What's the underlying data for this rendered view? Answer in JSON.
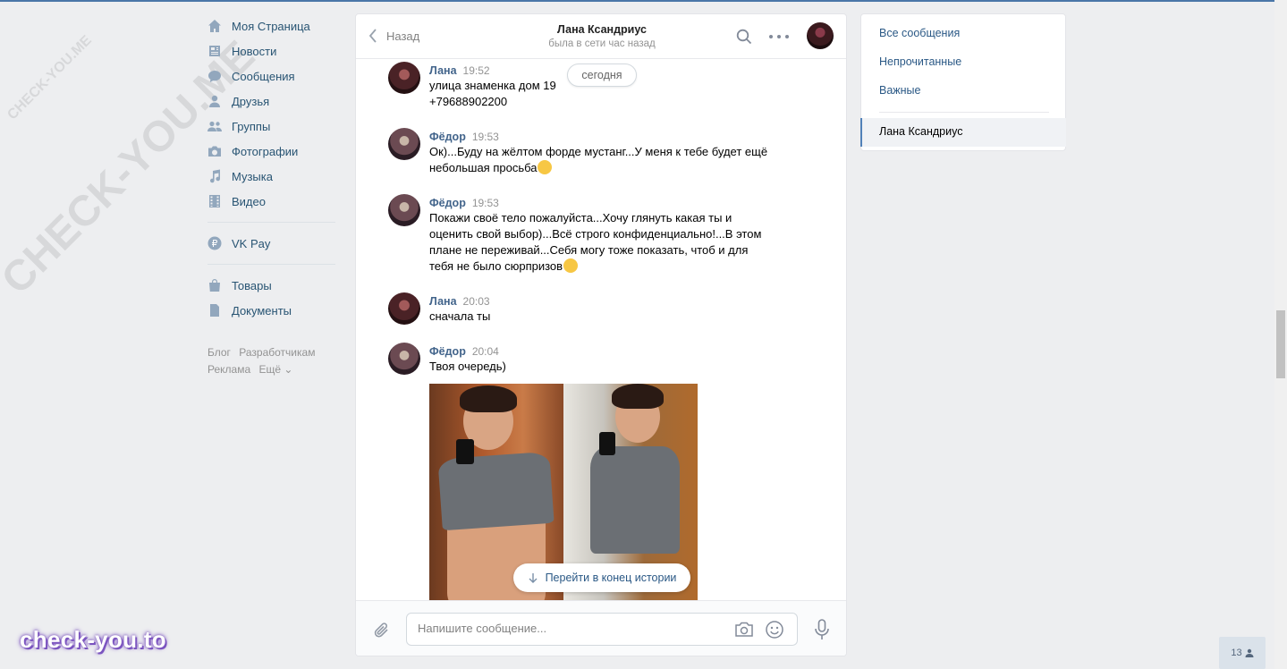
{
  "nav": {
    "items": [
      {
        "label": "Моя Страница",
        "icon": "home-icon"
      },
      {
        "label": "Новости",
        "icon": "news-icon"
      },
      {
        "label": "Сообщения",
        "icon": "messages-icon"
      },
      {
        "label": "Друзья",
        "icon": "friends-icon"
      },
      {
        "label": "Группы",
        "icon": "groups-icon"
      },
      {
        "label": "Фотографии",
        "icon": "camera-icon"
      },
      {
        "label": "Музыка",
        "icon": "music-icon"
      },
      {
        "label": "Видео",
        "icon": "video-icon"
      }
    ],
    "pay": {
      "label": "VK Pay",
      "icon": "ruble-icon"
    },
    "extra": [
      {
        "label": "Товары",
        "icon": "bag-icon"
      },
      {
        "label": "Документы",
        "icon": "document-icon"
      }
    ],
    "footer": [
      "Блог",
      "Разработчикам",
      "Реклама",
      "Ещё ⌄"
    ]
  },
  "chat": {
    "back_label": "Назад",
    "peer_name": "Лана Ксандриус",
    "peer_status": "была в сети час назад",
    "date_divider": "сегодня",
    "jump_label": "Перейти в конец истории",
    "composer_placeholder": "Напишите сообщение..."
  },
  "messages": [
    {
      "author": "Лана",
      "time": "19:52",
      "text": [
        "улица знаменка дом 19",
        "+79688902200"
      ]
    },
    {
      "author": "Фёдор",
      "time": "19:53",
      "text": [
        "Ок)...Буду на жёлтом форде мустанг...У меня к тебе будет ещё",
        "небольшая просьба"
      ]
    },
    {
      "author": "Фёдор",
      "time": "19:53",
      "text": [
        "Покажи своё тело пожалуйста...Хочу глянуть какая ты и",
        "оценить свой выбор)...Всё строго конфиденциально!...В этом",
        "плане не переживай...Себя могу тоже показать, чтоб и для",
        "тебя не было сюрпризов"
      ]
    },
    {
      "author": "Лана",
      "time": "20:03",
      "text": [
        "сначала ты"
      ]
    },
    {
      "author": "Фёдор",
      "time": "20:04",
      "text": [
        "Твоя очередь)"
      ]
    }
  ],
  "right_panel": {
    "filters": [
      "Все сообщения",
      "Непрочитанные",
      "Важные"
    ],
    "active_dialog": "Лана Ксандриус"
  },
  "watermark": {
    "small": "CHECK-YOU.ME",
    "large": "CHECK-YOU.ME",
    "brand": "check-you.to"
  },
  "counter": {
    "value": "13"
  },
  "colors": {
    "accent": "#4a76a8",
    "link": "#2a5885",
    "author": "#42648b",
    "background": "#edeef0"
  }
}
